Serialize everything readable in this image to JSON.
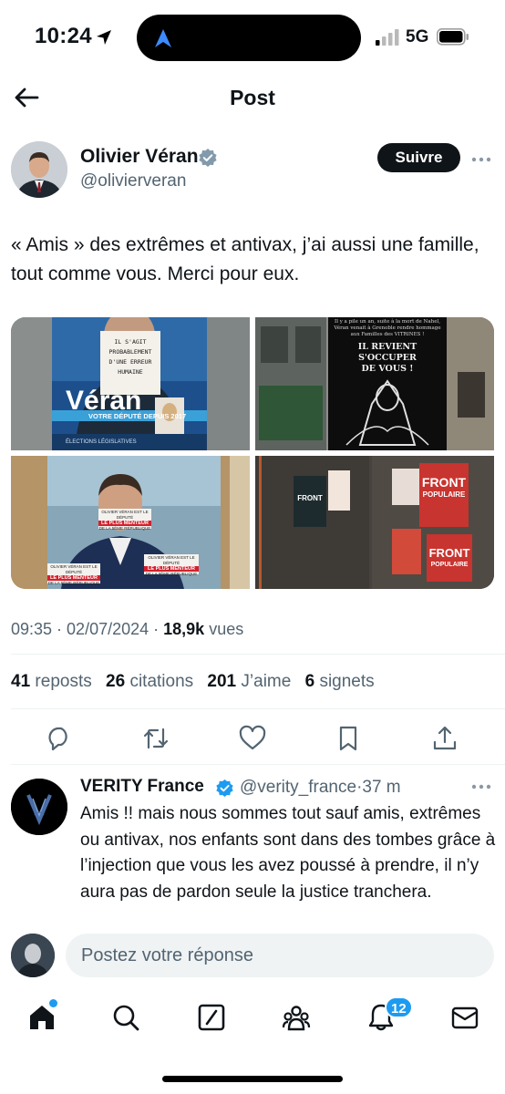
{
  "status_bar": {
    "time": "10:24",
    "network": "5G"
  },
  "header": {
    "title": "Post"
  },
  "post": {
    "author_name": "Olivier Véran",
    "author_handle": "@olivierveran",
    "follow_label": "Suivre",
    "text": "« Amis » des extrêmes et antivax, j’ai aussi une famille, tout comme vous. Merci pour eux.",
    "media": {
      "img1": {
        "note_lines": [
          "IL S'AGIT",
          "PROBABLEMENT",
          "D'UNE ERREUR",
          "HUMAINE"
        ],
        "poster_name": "Véran",
        "poster_banner": "VOTRE DÉPUTÉ DEPUIS 2017",
        "poster_footer": "ÉLECTIONS LÉGISLATIVES"
      },
      "img2": {
        "line1": "Il y a pile un an, suite à la mort de Nahel,",
        "line2": "Véran venait à Grenoble rendre hommage",
        "line3": "aux Familles des VITRINES !",
        "line4": "IL REVIENT",
        "line5": "S'OCCUPER",
        "line6": "DE VOUS !"
      },
      "img3": {
        "sticker_top": "OLIVIER VÉRAN EST LE DÉPUTÉ",
        "sticker_main": "LE PLUS MENTEUR",
        "sticker_sub": "DE LA 5ÈME RÉPUBLIQUE"
      },
      "img4": {
        "poster_word1": "FRONT",
        "poster_word2": "POPULAIRE",
        "poster_small": "FRONT"
      }
    },
    "time": "09:35",
    "date": "02/07/2024",
    "views_count": "18,9k",
    "views_label": "vues",
    "stats": {
      "reposts_count": "41",
      "reposts_label": "reposts",
      "quotes_count": "26",
      "quotes_label": "citations",
      "likes_count": "201",
      "likes_label": "J’aime",
      "bookmarks_count": "6",
      "bookmarks_label": "signets"
    }
  },
  "reply": {
    "name": "VERITY France",
    "handle": "@verity_france",
    "time": "37 m",
    "text": "Amis !! mais nous sommes tout sauf amis, extrêmes ou antivax, nos enfants sont dans des tombes grâce à l’injection que vous les avez poussé à prendre, il n’y aura pas de pardon seule la justice tranchera."
  },
  "composer": {
    "placeholder": "Postez votre réponse"
  },
  "nav": {
    "notifications_badge": "12"
  },
  "colors": {
    "accent": "#1d9bf0",
    "text": "#0f1419",
    "secondary": "#536471",
    "divider": "#eff3f4"
  },
  "icons": [
    "location-arrow-icon",
    "app-indicator-icon",
    "signal-icon",
    "battery-icon",
    "back-arrow-icon",
    "verified-badge-icon",
    "more-icon",
    "reply-icon",
    "repost-icon",
    "like-icon",
    "bookmark-icon",
    "share-icon",
    "home-icon",
    "search-icon",
    "grok-icon",
    "communities-icon",
    "notifications-icon",
    "messages-icon"
  ]
}
